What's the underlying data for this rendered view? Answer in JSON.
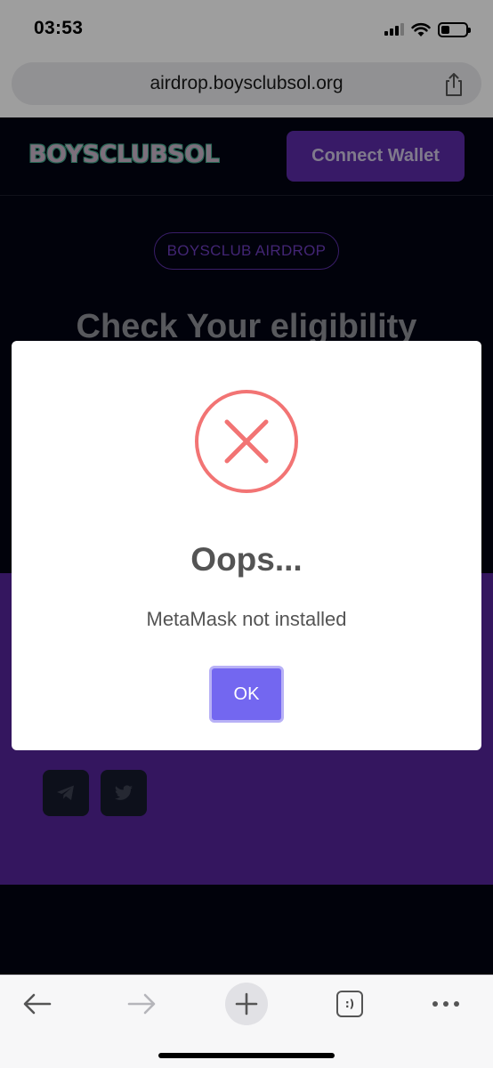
{
  "status_bar": {
    "time": "03:53"
  },
  "browser": {
    "url": "airdrop.boysclubsol.org"
  },
  "site": {
    "logo": "BOYSCLUBSOL",
    "connect_wallet": "Connect Wallet",
    "badge": "BOYSCLUB AIRDROP",
    "headline": "Check Your eligibility"
  },
  "modal": {
    "title": "Oops...",
    "message": "MetaMask not installed",
    "ok_label": "OK"
  },
  "toolbar": {
    "tabs_label": ":)"
  },
  "colors": {
    "page_background": "#020412",
    "brand_purple": "#5b2aa7",
    "section_purple": "#54249a",
    "error_red": "#f27474",
    "ok_button": "#7367f0"
  },
  "icons": [
    "signal-icon",
    "wifi-icon",
    "battery-icon",
    "share-icon",
    "telegram-icon",
    "twitter-icon",
    "error-x-icon",
    "back-arrow-icon",
    "forward-arrow-icon",
    "plus-icon",
    "tabs-icon",
    "more-icon"
  ]
}
